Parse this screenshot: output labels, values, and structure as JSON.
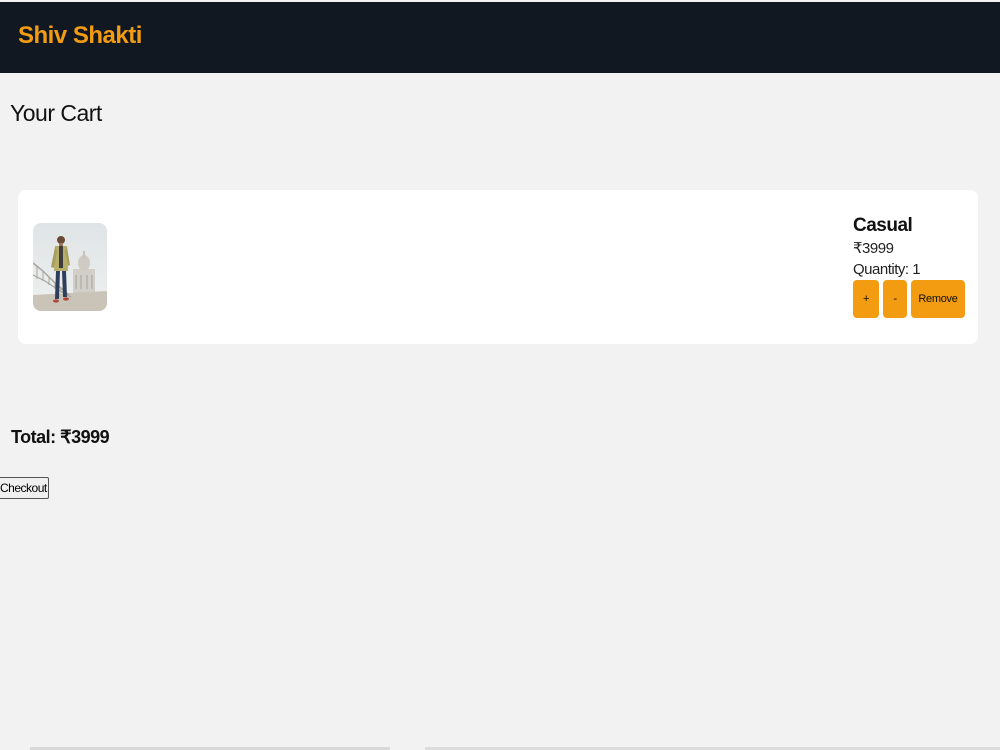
{
  "header": {
    "brand": "Shiv Shakti",
    "background_color": "#111821",
    "brand_color": "#f39c12"
  },
  "page": {
    "title": "Your Cart"
  },
  "cart": {
    "items": [
      {
        "name": "Casual",
        "price": "₹3999",
        "quantity_text": "Quantity: 1",
        "image_icon": "product-photo-man-walking-bridge",
        "buttons": {
          "plus": "+",
          "minus": "-",
          "remove": "Remove"
        }
      }
    ],
    "button_color": "#f39c12"
  },
  "summary": {
    "total_text": "Total: ₹3999",
    "checkout_label": "Checkout"
  }
}
